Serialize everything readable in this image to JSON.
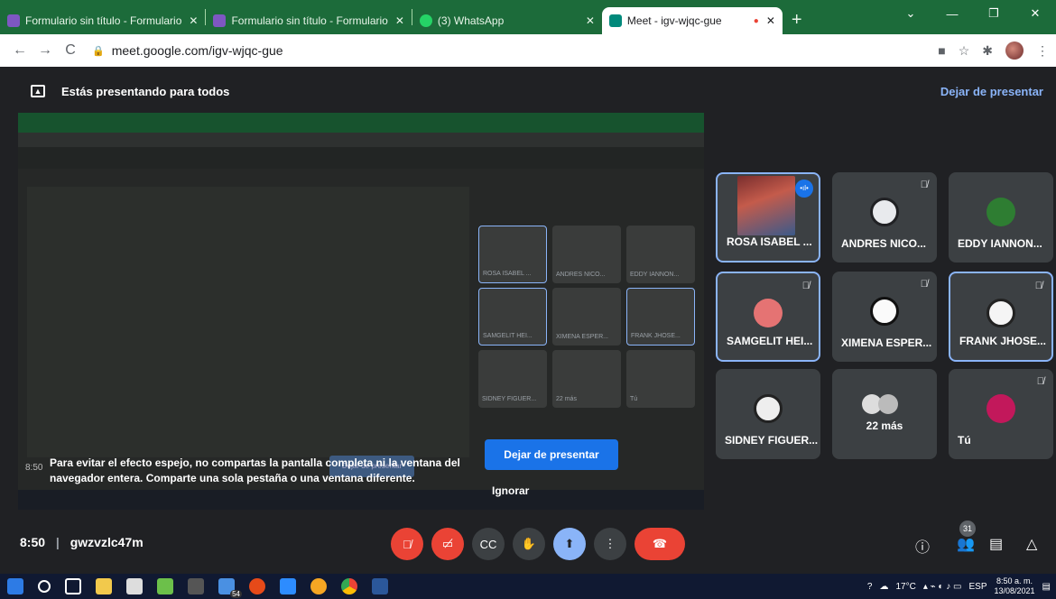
{
  "browser": {
    "tabs": [
      {
        "title": "Formulario sin título - Formulario",
        "color": "#7e57c2"
      },
      {
        "title": "Formulario sin título - Formulario",
        "color": "#7e57c2"
      },
      {
        "title": "(3) WhatsApp",
        "color": "#25d366"
      },
      {
        "title": "Meet - igv-wjqc-gue",
        "color": "#00897b"
      }
    ],
    "url": "meet.google.com/igv-wjqc-gue"
  },
  "banner": {
    "text": "Estás presentando para todos",
    "stop_label": "Dejar de presentar"
  },
  "shared": {
    "warning": "Para evitar el efecto espejo, no compartas la pantalla completa ni la ventana del navegador entera. Comparte una sola pestaña o una ventana diferente.",
    "warning_time": "8:50",
    "stop_button": "Dejar de presentar",
    "ignore_label": "Ignorar"
  },
  "participants": [
    {
      "name": "ROSA ISABEL ...",
      "speaking": true,
      "muted": false
    },
    {
      "name": "ANDRES NICO...",
      "speaking": false,
      "muted": true
    },
    {
      "name": "EDDY IANNON...",
      "speaking": false,
      "muted": false
    },
    {
      "name": "SAMGELIT HEI...",
      "speaking": true,
      "muted": true
    },
    {
      "name": "XIMENA ESPER...",
      "speaking": false,
      "muted": true
    },
    {
      "name": "FRANK JHOSE...",
      "speaking": true,
      "muted": true
    },
    {
      "name": "SIDNEY FIGUER...",
      "speaking": false,
      "muted": false
    },
    {
      "name": "22 más",
      "speaking": false,
      "muted": false
    },
    {
      "name": "Tú",
      "speaking": false,
      "muted": true
    }
  ],
  "meeting": {
    "time": "8:50",
    "code": "gwzvzlc47m",
    "participant_count": "31"
  },
  "taskbar": {
    "temp": "17°C",
    "lang": "ESP",
    "time": "8:50 a. m.",
    "date": "13/08/2021",
    "badge": "54"
  }
}
